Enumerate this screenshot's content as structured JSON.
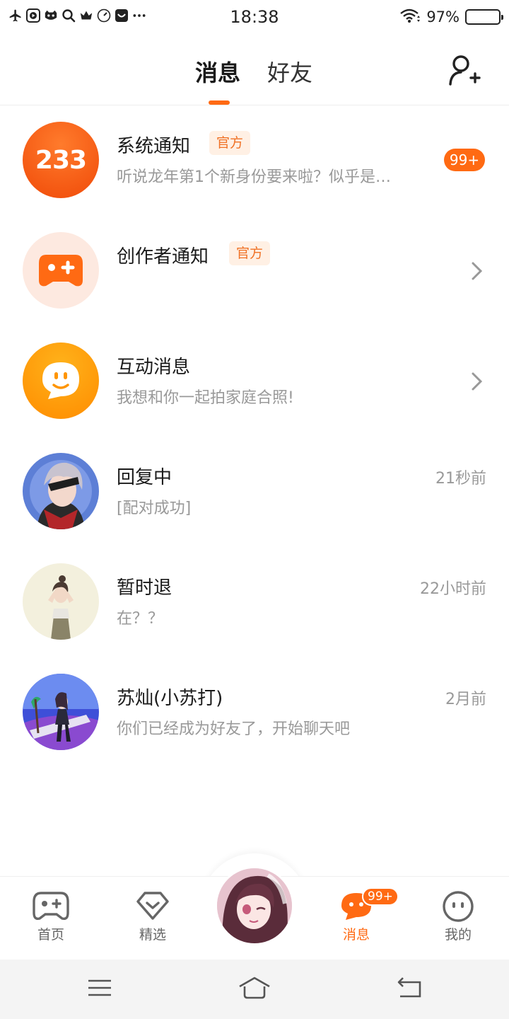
{
  "status_bar": {
    "time": "18:38",
    "battery_percent": "97%",
    "battery_level": 0.97,
    "left_icons": [
      "airplane-icon",
      "play-icon",
      "cat-icon",
      "search-icon",
      "crown-icon",
      "compass-icon",
      "app-icon",
      "more-dots-icon"
    ]
  },
  "header": {
    "tabs": [
      {
        "label": "消息",
        "active": true
      },
      {
        "label": "好友",
        "active": false
      }
    ],
    "add_friend_icon": "add-friend-icon"
  },
  "colors": {
    "accent": "#ff6a13",
    "tag_bg": "#fff0e4",
    "sub_text": "#999999"
  },
  "messages": [
    {
      "name": "系统通知",
      "tag": "官方",
      "preview": "听说龙年第1个新身份要来啦？似乎是…",
      "badge": "99+",
      "avatar_text": "233"
    },
    {
      "name": "创作者通知",
      "tag": "官方",
      "preview": "",
      "avatar_icon": "gamepad-plus-icon"
    },
    {
      "name": "互动消息",
      "preview": "我想和你一起拍家庭合照!",
      "avatar_icon": "chat-face-icon"
    },
    {
      "name": "回复中",
      "preview": "[配对成功]",
      "time": "21秒前"
    },
    {
      "name": "暂时退",
      "preview": "在？？",
      "time": "22小时前"
    },
    {
      "name": "苏灿(小苏打)",
      "preview": "你们已经成为好友了，开始聊天吧",
      "time": "2月前"
    }
  ],
  "bottom_nav": {
    "items": [
      {
        "label": "首页",
        "icon": "gamepad-icon"
      },
      {
        "label": "精选",
        "icon": "heart-diamond-icon"
      },
      {
        "label": "消息",
        "icon": "message-icon",
        "badge": "99+",
        "active": true
      },
      {
        "label": "我的",
        "icon": "face-icon"
      }
    ]
  },
  "system_nav": [
    "menu-icon",
    "home-icon",
    "back-icon"
  ]
}
